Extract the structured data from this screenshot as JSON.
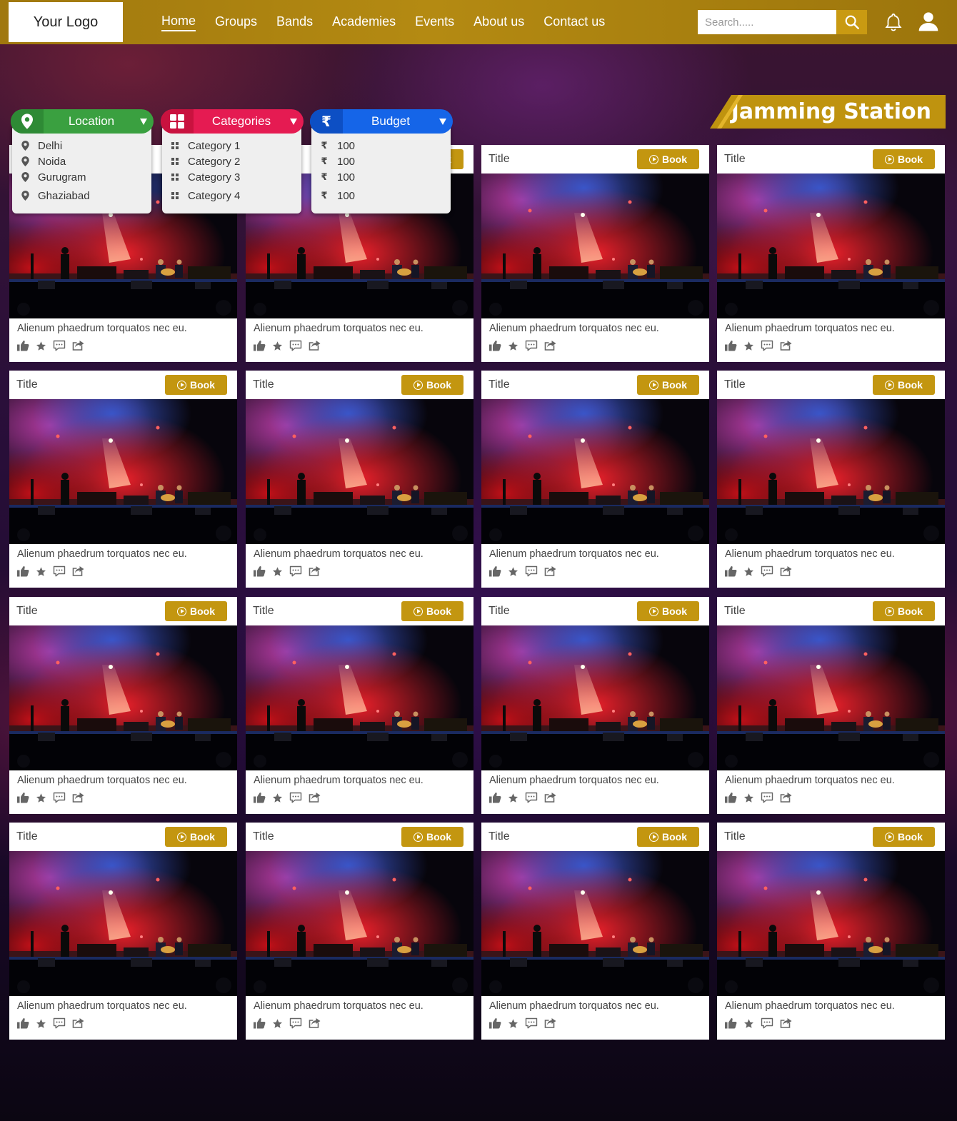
{
  "header": {
    "logo": "Your Logo",
    "nav": [
      "Home",
      "Groups",
      "Bands",
      "Academies",
      "Events",
      "About us",
      "Contact us"
    ],
    "search_placeholder": "Search.....",
    "accent_color": "#b48a12"
  },
  "page_title": "Jamming Station",
  "filters": {
    "location": {
      "label": "Location",
      "color": "#3aa040",
      "icon": "map-pin-icon",
      "options": [
        "Delhi",
        "Noida",
        "Gurugram",
        "Ghaziabad"
      ]
    },
    "categories": {
      "label": "Categories",
      "color": "#e51b52",
      "icon": "grid-icon",
      "options": [
        "Category 1",
        "Category 2",
        "Category 3",
        "Category 4"
      ]
    },
    "budget": {
      "label": "Budget",
      "color": "#1565e8",
      "icon": "rupee-icon",
      "options": [
        "100",
        "100",
        "100",
        "100"
      ]
    }
  },
  "cards": {
    "title": "Title",
    "book_label": "Book",
    "description": "Alienum phaedrum torquatos nec eu.",
    "action_icons": [
      "thumbs-up-icon",
      "star-icon",
      "comment-icon",
      "share-icon"
    ],
    "rows": 4,
    "columns": 4
  }
}
